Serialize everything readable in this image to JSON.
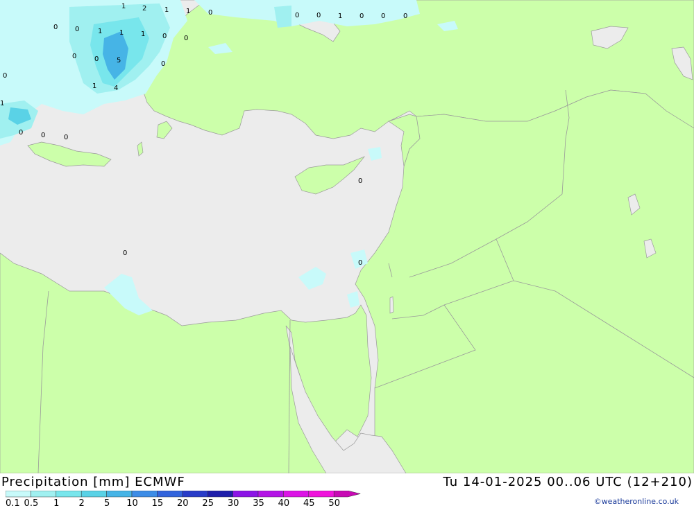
{
  "title": "Precipitation [mm] ECMWF",
  "datetime": "Tu 14-01-2025 00..06 UTC (12+210)",
  "credit": "©weatheronline.co.uk",
  "colors": {
    "land": "#ccffaa",
    "sea": "#ececec",
    "border": "#9a9a9a"
  },
  "legend": {
    "labels": [
      "0.1",
      "0.5",
      "1",
      "2",
      "5",
      "10",
      "15",
      "20",
      "25",
      "30",
      "35",
      "40",
      "45",
      "50"
    ],
    "colors": [
      "#c8fafa",
      "#a0f0f0",
      "#78e6ec",
      "#5ad2e6",
      "#46b4e6",
      "#3c8ce6",
      "#3264dc",
      "#283cc8",
      "#1e1eaa",
      "#8c14e6",
      "#b414e6",
      "#dc14e6",
      "#f014dc",
      "#c80ab4"
    ]
  },
  "precip_values": [
    "1",
    "2",
    "1",
    "1",
    "0",
    "0",
    "0",
    "1",
    "1",
    "1",
    "0",
    "0",
    "0",
    "0",
    "5",
    "0",
    "1",
    "4",
    "0",
    "1",
    "0",
    "0",
    "0",
    "0",
    "0",
    "1",
    "0",
    "0",
    "0",
    "0",
    "0",
    "0"
  ]
}
